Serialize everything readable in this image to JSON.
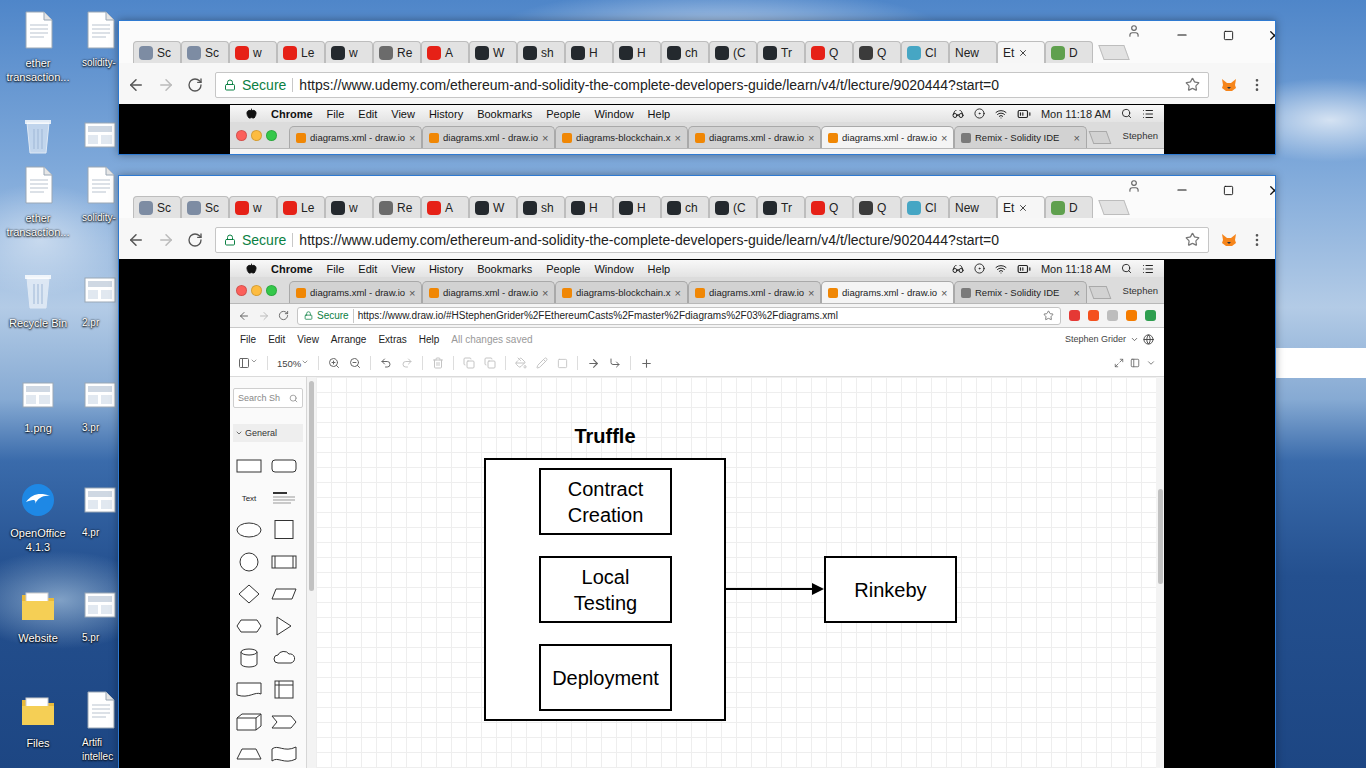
{
  "desktop": {
    "strips": [
      {
        "icons": [
          {
            "label": "ether transaction...",
            "kind": "document"
          },
          {
            "label": "solidity-",
            "kind": "document"
          },
          {
            "kind": "recycle-bin"
          },
          {
            "kind": "image"
          }
        ]
      },
      {
        "icons": [
          {
            "label": "ether transaction...",
            "kind": "document"
          },
          {
            "label": "solidity-",
            "kind": "document"
          },
          {
            "label": "Recycle Bin",
            "kind": "recycle-bin"
          },
          {
            "label": "2.pr",
            "kind": "image"
          },
          {
            "label": "1.png",
            "kind": "image"
          },
          {
            "label": "3.pr",
            "kind": "image"
          },
          {
            "label": "OpenOffice 4.1.3",
            "kind": "app"
          },
          {
            "label": "4.pr",
            "kind": "image"
          },
          {
            "label": "Website",
            "kind": "folder"
          },
          {
            "label": "5.pr",
            "kind": "image"
          },
          {
            "label": "Files",
            "kind": "folder"
          },
          {
            "label": "Artifi intellec",
            "kind": "document"
          }
        ]
      }
    ]
  },
  "windows": [
    {
      "tabs": [
        {
          "label": "Sc",
          "selected": false,
          "color": "#7d8ca3"
        },
        {
          "label": "Sc",
          "selected": false,
          "color": "#7d8ca3"
        },
        {
          "label": "w",
          "selected": false,
          "color": "#e62117"
        },
        {
          "label": "Le",
          "selected": false,
          "color": "#e62117"
        },
        {
          "label": "w",
          "selected": false,
          "color": "#24292e"
        },
        {
          "label": "Re",
          "selected": false,
          "color": "#6b6b6b"
        },
        {
          "label": "A",
          "selected": false,
          "color": "#e62117"
        },
        {
          "label": "W",
          "selected": false,
          "color": "#24292e"
        },
        {
          "label": "sh",
          "selected": false,
          "color": "#24292e"
        },
        {
          "label": "H",
          "selected": false,
          "color": "#24292e"
        },
        {
          "label": "H",
          "selected": false,
          "color": "#24292e"
        },
        {
          "label": "ch",
          "selected": false,
          "color": "#24292e"
        },
        {
          "label": "(C",
          "selected": false,
          "color": "#24292e"
        },
        {
          "label": "Tr",
          "selected": false,
          "color": "#24292e"
        },
        {
          "label": "Q",
          "selected": false,
          "color": "#e62117"
        },
        {
          "label": "Q",
          "selected": false,
          "color": "#3b3b3b"
        },
        {
          "label": "Cl",
          "selected": false,
          "color": "#46a6c4"
        },
        {
          "label": "New",
          "selected": false
        },
        {
          "label": "Et",
          "selected": true
        },
        {
          "label": "D",
          "selected": false,
          "color": "#5fa04e"
        }
      ],
      "address": {
        "secure": "Secure",
        "url": "https://www.udemy.com/ethereum-and-solidity-the-complete-developers-guide/learn/v4/t/lecture/9020444?start=0"
      },
      "mac": {
        "menu": {
          "app": "Chrome",
          "items": [
            "File",
            "Edit",
            "View",
            "History",
            "Bookmarks",
            "People",
            "Window",
            "Help"
          ],
          "clock": "Mon 11:18 AM"
        },
        "tabs": [
          {
            "label": "diagrams.xml - draw.io",
            "selected": false,
            "color": "#f08705"
          },
          {
            "label": "diagrams.xml - draw.io",
            "selected": false,
            "color": "#f08705"
          },
          {
            "label": "diagrams-blockchain.x",
            "selected": false,
            "color": "#f08705"
          },
          {
            "label": "diagrams.xml - draw.io",
            "selected": false,
            "color": "#f08705"
          },
          {
            "label": "diagrams.xml - draw.io",
            "selected": true,
            "color": "#f08705"
          },
          {
            "label": "Remix - Solidity IDE",
            "selected": false,
            "color": "#7a7a7a"
          }
        ],
        "close": "×",
        "profile": "Stephen"
      }
    },
    {
      "tabs": [
        {
          "label": "Sc",
          "selected": false,
          "color": "#7d8ca3"
        },
        {
          "label": "Sc",
          "selected": false,
          "color": "#7d8ca3"
        },
        {
          "label": "w",
          "selected": false,
          "color": "#e62117"
        },
        {
          "label": "Le",
          "selected": false,
          "color": "#e62117"
        },
        {
          "label": "w",
          "selected": false,
          "color": "#24292e"
        },
        {
          "label": "Re",
          "selected": false,
          "color": "#6b6b6b"
        },
        {
          "label": "A",
          "selected": false,
          "color": "#e62117"
        },
        {
          "label": "W",
          "selected": false,
          "color": "#24292e"
        },
        {
          "label": "sh",
          "selected": false,
          "color": "#24292e"
        },
        {
          "label": "H",
          "selected": false,
          "color": "#24292e"
        },
        {
          "label": "H",
          "selected": false,
          "color": "#24292e"
        },
        {
          "label": "ch",
          "selected": false,
          "color": "#24292e"
        },
        {
          "label": "(C",
          "selected": false,
          "color": "#24292e"
        },
        {
          "label": "Tr",
          "selected": false,
          "color": "#24292e"
        },
        {
          "label": "Q",
          "selected": false,
          "color": "#e62117"
        },
        {
          "label": "Q",
          "selected": false,
          "color": "#3b3b3b"
        },
        {
          "label": "Cl",
          "selected": false,
          "color": "#46a6c4"
        },
        {
          "label": "New",
          "selected": false
        },
        {
          "label": "Et",
          "selected": true
        },
        {
          "label": "D",
          "selected": false,
          "color": "#5fa04e"
        }
      ],
      "address": {
        "secure": "Secure",
        "url": "https://www.udemy.com/ethereum-and-solidity-the-complete-developers-guide/learn/v4/t/lecture/9020444?start=0"
      },
      "mac": {
        "menu": {
          "app": "Chrome",
          "items": [
            "File",
            "Edit",
            "View",
            "History",
            "Bookmarks",
            "People",
            "Window",
            "Help"
          ],
          "clock": "Mon 11:18 AM"
        },
        "tabs": [
          {
            "label": "diagrams.xml - draw.io",
            "selected": false,
            "color": "#f08705"
          },
          {
            "label": "diagrams.xml - draw.io",
            "selected": false,
            "color": "#f08705"
          },
          {
            "label": "diagrams-blockchain.x",
            "selected": false,
            "color": "#f08705"
          },
          {
            "label": "diagrams.xml - draw.io",
            "selected": false,
            "color": "#f08705"
          },
          {
            "label": "diagrams.xml - draw.io",
            "selected": true,
            "color": "#f08705"
          },
          {
            "label": "Remix - Solidity IDE",
            "selected": false,
            "color": "#7a7a7a"
          }
        ],
        "close": "×",
        "profile": "Stephen",
        "address": {
          "secure": "Secure",
          "url": "https://www.draw.io/#HStephenGrider%2FEthereumCasts%2Fmaster%2Fdiagrams%2F03%2Fdiagrams.xml"
        }
      },
      "drawio": {
        "menu": [
          "File",
          "Edit",
          "View",
          "Arrange",
          "Extras",
          "Help"
        ],
        "status": "All changes saved",
        "user": "Stephen Grider",
        "zoom": "150%",
        "search": "Search Sh",
        "palette": "General",
        "text_shape": "Text",
        "diagram": {
          "title": "Truffle",
          "steps": [
            "Contract Creation",
            "Local Testing",
            "Deployment"
          ],
          "target": "Rinkeby"
        }
      }
    }
  ]
}
